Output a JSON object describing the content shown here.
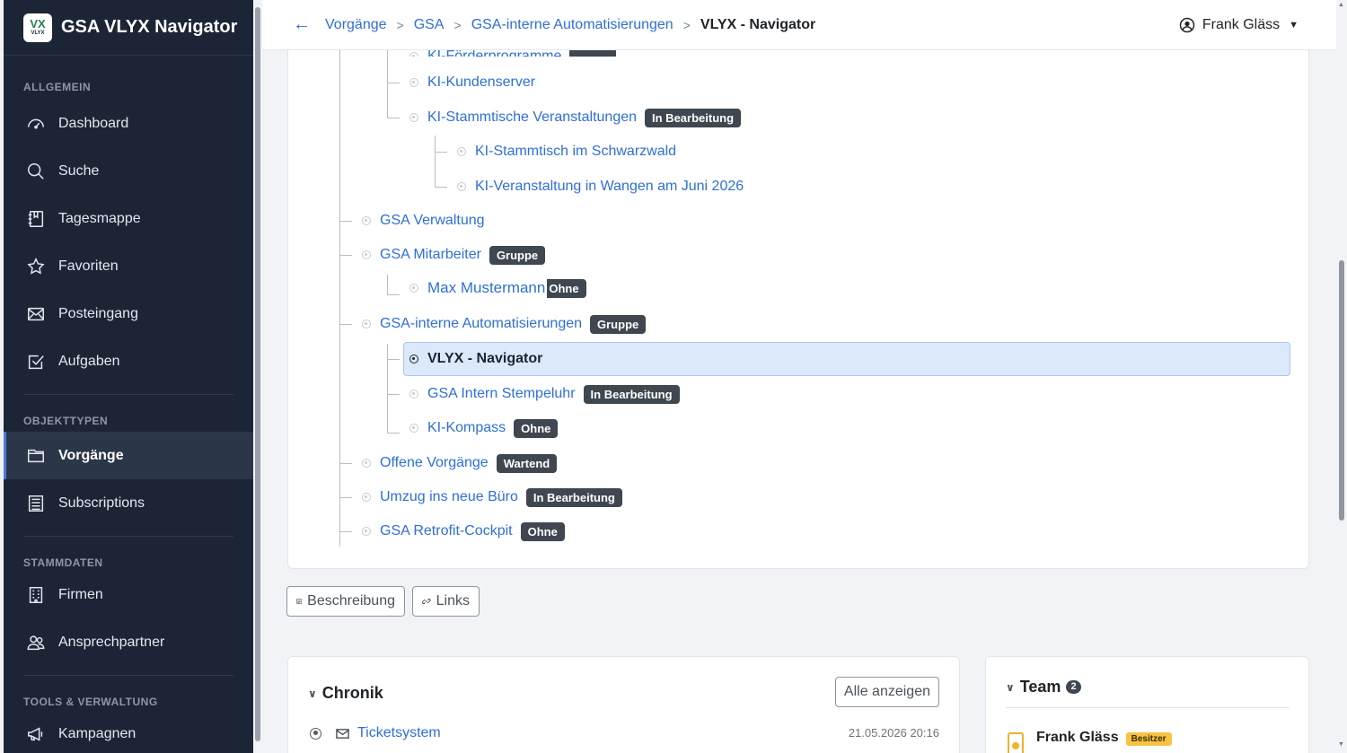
{
  "app": {
    "title": "GSA VLYX Navigator",
    "logo_mark": "VX",
    "logo_sub": "VLYX"
  },
  "sidebar": {
    "sections": [
      {
        "label": "ALLGEMEIN",
        "items": [
          {
            "label": "Dashboard",
            "icon": "dashboard-icon"
          },
          {
            "label": "Suche",
            "icon": "search-icon"
          },
          {
            "label": "Tagesmappe",
            "icon": "journal-icon"
          },
          {
            "label": "Favoriten",
            "icon": "star-icon"
          },
          {
            "label": "Posteingang",
            "icon": "envelope-icon"
          },
          {
            "label": "Aufgaben",
            "icon": "checkbox-icon"
          }
        ]
      },
      {
        "label": "OBJEKTTYPEN",
        "items": [
          {
            "label": "Vorgänge",
            "icon": "folder-icon",
            "active": true
          },
          {
            "label": "Subscriptions",
            "icon": "list-icon"
          }
        ]
      },
      {
        "label": "STAMMDATEN",
        "items": [
          {
            "label": "Firmen",
            "icon": "building-icon"
          },
          {
            "label": "Ansprechpartner",
            "icon": "people-icon"
          }
        ]
      },
      {
        "label": "TOOLS & VERWALTUNG",
        "items": [
          {
            "label": "Kampagnen",
            "icon": "megaphone-icon"
          }
        ]
      }
    ]
  },
  "header": {
    "back_icon": "←",
    "breadcrumb": [
      "Vorgänge",
      "GSA",
      "GSA-interne Automatisierungen"
    ],
    "current": "VLYX - Navigator",
    "user": "Frank Gläss"
  },
  "tree": [
    {
      "label": "KI-Förderprogramme",
      "badge": "",
      "partial": true
    },
    {
      "label": "KI-Kundenserver",
      "badge": ""
    },
    {
      "label": "KI-Stammtische Veranstaltungen",
      "badge": "In Bearbeitung"
    },
    {
      "label": "KI-Stammtisch im Schwarzwald",
      "badge": ""
    },
    {
      "label": "KI-Veranstaltung in Wangen am Juni 2026",
      "badge": ""
    },
    {
      "label": "GSA Verwaltung",
      "badge": ""
    },
    {
      "label": "GSA Mitarbeiter",
      "badge": "Gruppe"
    },
    {
      "label": "Max Mustermann",
      "badge": "Ohne"
    },
    {
      "label": "GSA-interne Automatisierungen",
      "badge": "Gruppe"
    },
    {
      "label": "VLYX - Navigator",
      "badge": "",
      "selected": true
    },
    {
      "label": "GSA Intern Stempeluhr",
      "badge": "In Bearbeitung"
    },
    {
      "label": "KI-Kompass",
      "badge": "Ohne"
    },
    {
      "label": "Offene Vorgänge",
      "badge": "Wartend"
    },
    {
      "label": "Umzug ins neue Büro",
      "badge": "In Bearbeitung"
    },
    {
      "label": "GSA Retrofit-Cockpit",
      "badge": "Ohne"
    }
  ],
  "actions": {
    "description": "Beschreibung",
    "links": "Links"
  },
  "chronik": {
    "title": "Chronik",
    "show_all": "Alle anzeigen",
    "entries": [
      {
        "title": "Ticketsystem",
        "date": "21.05.2026 20:16"
      }
    ]
  },
  "team": {
    "title": "Team",
    "count": "2",
    "members": [
      {
        "name": "Frank Gläss",
        "role": "Besitzer"
      }
    ]
  },
  "colors": {
    "sidebar": "#1c2536",
    "link": "#2f6fd8",
    "badge": "#3f4750",
    "selected": "#dce9fb"
  }
}
